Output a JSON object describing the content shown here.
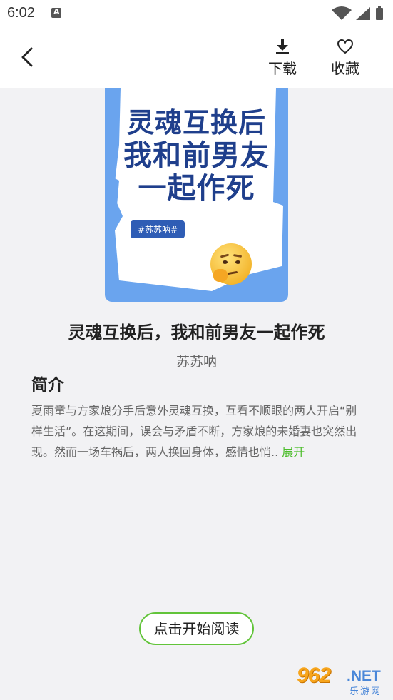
{
  "status_bar": {
    "time": "6:02"
  },
  "header": {
    "download_label": "下载",
    "favorite_label": "收藏"
  },
  "cover": {
    "title_line1": "灵魂互换后",
    "title_line2": "我和前男友",
    "title_line3": "一起作死",
    "tag": "#苏苏呐#"
  },
  "book": {
    "title": "灵魂互换后，我和前男友一起作死",
    "author": "苏苏呐"
  },
  "intro": {
    "heading": "简介",
    "text": "夏雨童与方家烺分手后意外灵魂互换，互看不顺眼的两人开启“别样生活”。在这期间，误会与矛盾不断，方家烺的未婚妻也突然出现。然而一场车祸后，两人换回身体，感情也悄..",
    "expand_label": "展开"
  },
  "read_button_label": "点击开始阅读",
  "watermark": {
    "number": "962",
    "domain": ".NET",
    "cn": "乐游网"
  },
  "colors": {
    "accent_green": "#4cbd2b",
    "cover_blue": "#6aa4ee",
    "cover_title": "#1f3f8c"
  }
}
